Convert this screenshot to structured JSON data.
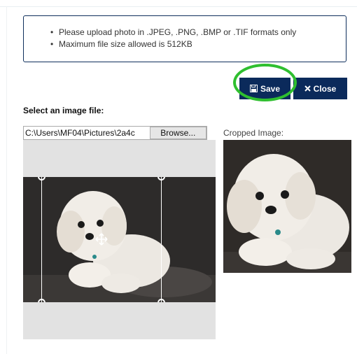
{
  "notice": {
    "items": [
      "Please upload photo in .JPEG, .PNG, .BMP or .TIF formats only",
      "Maximum file size allowed is 512KB"
    ]
  },
  "toolbar": {
    "save_label": "Save",
    "close_label": "Close",
    "save_icon": "floppy-disk-icon",
    "close_icon": "x-close-icon"
  },
  "upload": {
    "label": "Select an image file:",
    "file_path": "C:\\Users\\MF04\\Pictures\\2a4c",
    "browse_label": "Browse..."
  },
  "cropper": {
    "move_icon": "move-arrows-icon"
  },
  "preview": {
    "label": "Cropped Image:"
  },
  "colors": {
    "button_bg": "#0b2a5b",
    "highlight_ring": "#2fbf2f",
    "notice_border": "#0f2f5c"
  }
}
